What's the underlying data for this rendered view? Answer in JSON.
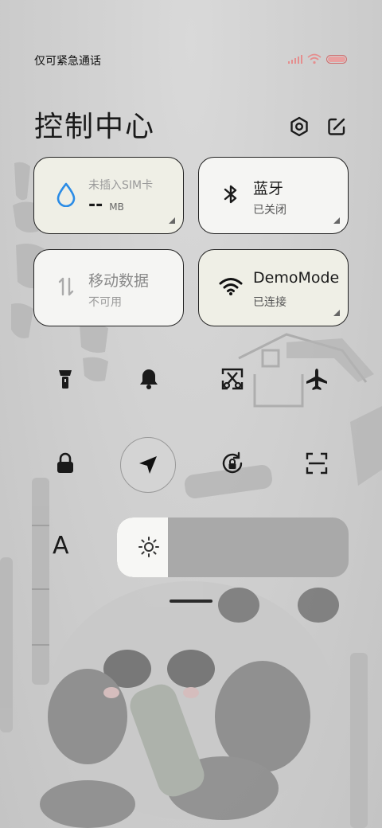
{
  "status_bar": {
    "carrier": "仅可紧急通话",
    "colors": {
      "signal": "#e58e8e",
      "battery": "#cf6f6f"
    },
    "icons": [
      "signal-bars-icon",
      "wifi-icon",
      "battery-icon"
    ]
  },
  "header": {
    "title": "控制中心",
    "buttons": [
      "settings-icon",
      "edit-icon"
    ]
  },
  "tiles": [
    {
      "id": "data-usage",
      "icon": "water-drop-icon",
      "main": "未插入SIM卡",
      "value": "--",
      "unit": "MB",
      "state": "inactive"
    },
    {
      "id": "bluetooth",
      "icon": "bluetooth-icon",
      "main": "蓝牙",
      "sub": "已关闭",
      "state": "off"
    },
    {
      "id": "mobile-data",
      "icon": "data-arrows-icon",
      "main": "移动数据",
      "sub": "不可用",
      "state": "unavailable"
    },
    {
      "id": "wifi",
      "icon": "wifi-icon",
      "main": "DemoMode",
      "sub": "已连接",
      "state": "on"
    }
  ],
  "quick_toggles": [
    [
      "flashlight-icon",
      "bell-icon",
      "screenshot-scissors-icon",
      "airplane-icon"
    ],
    [
      "lock-icon",
      "location-icon",
      "rotation-lock-icon",
      "scan-icon"
    ]
  ],
  "brightness": {
    "label": "A",
    "icon": "sun-icon",
    "level": 0.22
  },
  "colors": {
    "accent_blue": "#2b8ce6",
    "tile_bg": "#f5f5f3"
  }
}
